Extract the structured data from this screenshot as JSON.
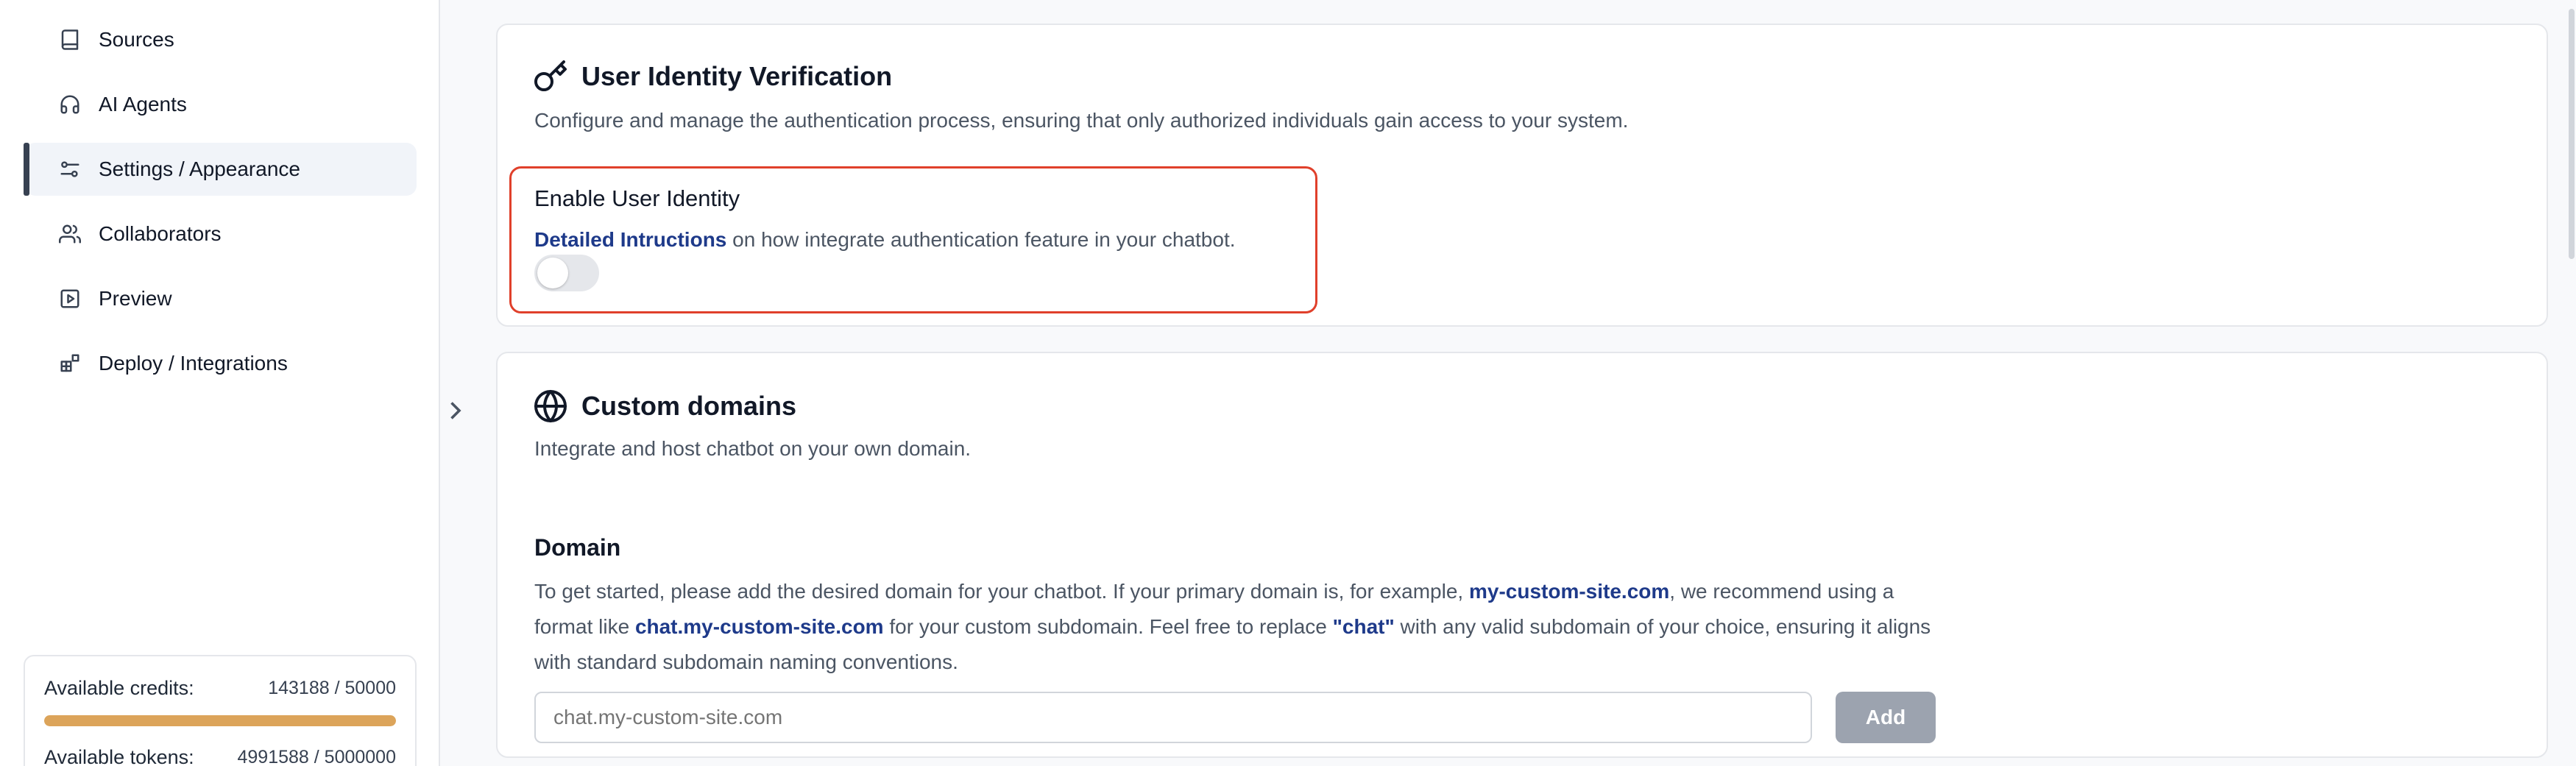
{
  "sidebar": {
    "items": [
      {
        "label": "Sources",
        "icon": "book-icon"
      },
      {
        "label": "AI Agents",
        "icon": "headphones-icon"
      },
      {
        "label": "Settings / Appearance",
        "icon": "sliders-icon",
        "active": true
      },
      {
        "label": "Collaborators",
        "icon": "users-icon"
      },
      {
        "label": "Preview",
        "icon": "play-square-icon"
      },
      {
        "label": "Deploy / Integrations",
        "icon": "blocks-icon"
      }
    ],
    "credits": {
      "credits_label": "Available credits:",
      "credits_value": "143188 / 50000",
      "credits_progress": 1.0,
      "tokens_label": "Available tokens:",
      "tokens_value": "4991588 / 5000000"
    }
  },
  "identity": {
    "title": "User Identity Verification",
    "description": "Configure and manage the authentication process, ensuring that only authorized individuals gain access to your system.",
    "enable_label": "Enable User Identity",
    "link_text": "Detailed Intructions",
    "link_suffix": " on how integrate authentication feature in your chatbot.",
    "enabled": false
  },
  "domains": {
    "title": "Custom domains",
    "description": "Integrate and host chatbot on your own domain.",
    "domain_label": "Domain",
    "help": {
      "p1": "To get started, please add the desired domain for your chatbot. If your primary domain is, for example, ",
      "b1": "my-custom-site.com",
      "p2": ", we recommend using a format like ",
      "b2": "chat.my-custom-site.com",
      "p3": " for your custom subdomain. Feel free to replace ",
      "b3": "\"chat\"",
      "p4": " with any valid subdomain of your choice, ensuring it aligns with standard subdomain naming conventions."
    },
    "input_placeholder": "chat.my-custom-site.com",
    "add_label": "Add"
  },
  "colors": {
    "accent_link": "#1e3a8a",
    "highlight_border": "#e0402b",
    "progress_fill": "#dca45a"
  }
}
